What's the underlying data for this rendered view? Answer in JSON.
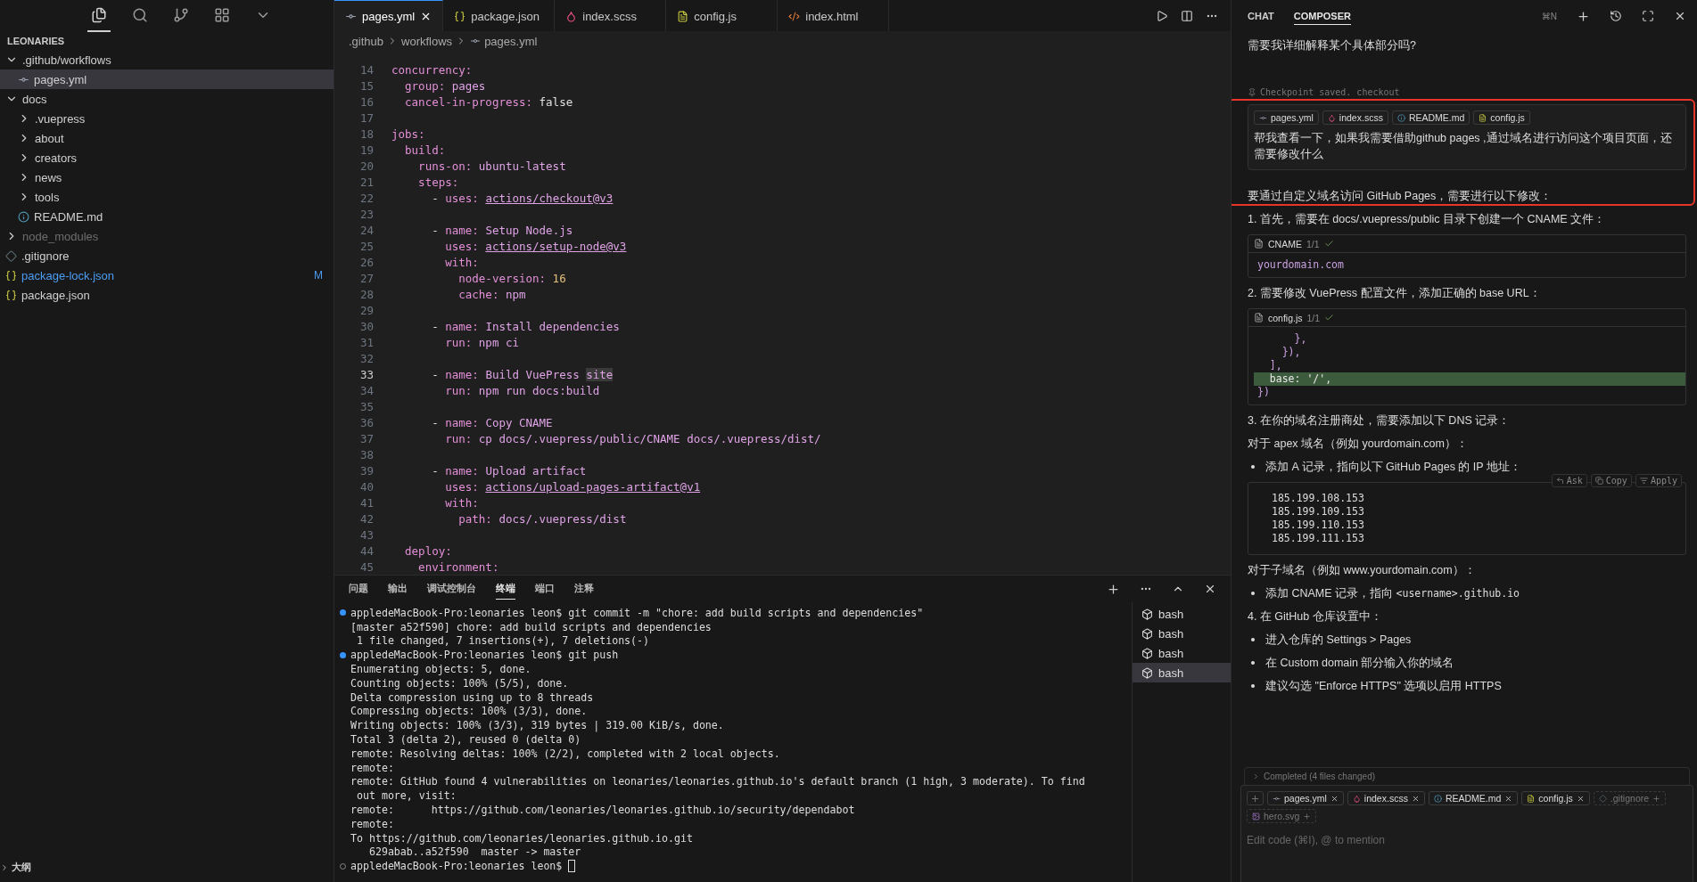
{
  "activity": [
    {
      "kind": "files",
      "selected": true
    },
    {
      "kind": "search",
      "selected": false
    },
    {
      "kind": "branch",
      "selected": false
    },
    {
      "kind": "extensions",
      "selected": false
    },
    {
      "kind": "more",
      "selected": false
    }
  ],
  "explorer": {
    "title": "LEONARIES",
    "items": [
      {
        "label": ".github/workflows",
        "kind": "folder",
        "expanded": true,
        "selected": false,
        "ignored": false,
        "children": [
          {
            "label": "pages.yml",
            "kind": "yml",
            "selected": true,
            "ignored": false
          }
        ]
      },
      {
        "label": "docs",
        "kind": "folder",
        "expanded": true,
        "selected": false,
        "ignored": false,
        "children": [
          {
            "label": ".vuepress",
            "kind": "folder",
            "expanded": false,
            "selected": false,
            "ignored": false
          },
          {
            "label": "about",
            "kind": "folder",
            "expanded": false,
            "selected": false,
            "ignored": false
          },
          {
            "label": "creators",
            "kind": "folder",
            "expanded": false,
            "selected": false,
            "ignored": false
          },
          {
            "label": "news",
            "kind": "folder",
            "expanded": false,
            "selected": false,
            "ignored": false
          },
          {
            "label": "tools",
            "kind": "folder",
            "expanded": false,
            "selected": false,
            "ignored": false
          },
          {
            "label": "README.md",
            "kind": "md",
            "selected": false,
            "ignored": false
          }
        ]
      },
      {
        "label": "node_modules",
        "kind": "folder",
        "expanded": false,
        "selected": false,
        "ignored": true
      },
      {
        "label": ".gitignore",
        "kind": "git",
        "selected": false,
        "ignored": false
      },
      {
        "label": "package-lock.json",
        "kind": "json",
        "selected": false,
        "ignored": false,
        "badge": "M"
      },
      {
        "label": "package.json",
        "kind": "json",
        "selected": false,
        "ignored": false
      }
    ],
    "sections": [
      "大纲"
    ]
  },
  "editor": {
    "tabs": [
      {
        "label": "pages.yml",
        "kind": "yml",
        "selected": true
      },
      {
        "label": "package.json",
        "kind": "json",
        "selected": false
      },
      {
        "label": "index.scss",
        "kind": "scss",
        "selected": false
      },
      {
        "label": "config.js",
        "kind": "js",
        "selected": false
      },
      {
        "label": "index.html",
        "kind": "html",
        "selected": false
      }
    ],
    "breadcrumb": [
      {
        "label": ".github",
        "kind": "folder"
      },
      {
        "label": "workflows",
        "kind": "folder"
      },
      {
        "label": "pages.yml",
        "kind": "yml"
      }
    ],
    "lines": [
      {
        "n": "14",
        "current": false,
        "parts": [
          {
            "kind": "key",
            "text": "concurrency:"
          }
        ]
      },
      {
        "n": "15",
        "current": false,
        "parts": [
          {
            "kind": "key",
            "text": "  group:"
          },
          {
            "kind": "str",
            "text": " pages"
          }
        ]
      },
      {
        "n": "16",
        "current": false,
        "parts": [
          {
            "kind": "key",
            "text": "  cancel-in-progress:"
          },
          {
            "kind": "plain",
            "text": " false"
          }
        ]
      },
      {
        "n": "17",
        "current": false
      },
      {
        "n": "18",
        "current": false,
        "parts": [
          {
            "kind": "key",
            "text": "jobs:"
          }
        ]
      },
      {
        "n": "19",
        "current": false,
        "parts": [
          {
            "kind": "key",
            "text": "  build:"
          }
        ]
      },
      {
        "n": "20",
        "current": false,
        "parts": [
          {
            "kind": "key",
            "text": "    runs-on:"
          },
          {
            "kind": "str",
            "text": " ubuntu-latest"
          }
        ]
      },
      {
        "n": "21",
        "current": false,
        "parts": [
          {
            "kind": "key",
            "text": "    steps:"
          }
        ]
      },
      {
        "n": "22",
        "current": false,
        "parts": [
          {
            "kind": "plain",
            "text": "      - "
          },
          {
            "kind": "key",
            "text": "uses: "
          },
          {
            "kind": "link",
            "text": "actions/checkout@v3"
          }
        ]
      },
      {
        "n": "23",
        "current": false
      },
      {
        "n": "24",
        "current": false,
        "parts": [
          {
            "kind": "plain",
            "text": "      - "
          },
          {
            "kind": "key",
            "text": "name:"
          },
          {
            "kind": "str",
            "text": " Setup Node.js"
          }
        ]
      },
      {
        "n": "25",
        "current": false,
        "parts": [
          {
            "kind": "key",
            "text": "        uses: "
          },
          {
            "kind": "link",
            "text": "actions/setup-node@v3"
          }
        ]
      },
      {
        "n": "26",
        "current": false,
        "parts": [
          {
            "kind": "key",
            "text": "        with:"
          }
        ]
      },
      {
        "n": "27",
        "current": false,
        "parts": [
          {
            "kind": "key",
            "text": "          node-version:"
          },
          {
            "kind": "num",
            "text": " 16"
          }
        ]
      },
      {
        "n": "28",
        "current": false,
        "parts": [
          {
            "kind": "key",
            "text": "          cache:"
          },
          {
            "kind": "str",
            "text": " npm"
          }
        ]
      },
      {
        "n": "29",
        "current": false
      },
      {
        "n": "30",
        "current": false,
        "parts": [
          {
            "kind": "plain",
            "text": "      - "
          },
          {
            "kind": "key",
            "text": "name:"
          },
          {
            "kind": "str",
            "text": " Install dependencies"
          }
        ]
      },
      {
        "n": "31",
        "current": false,
        "parts": [
          {
            "kind": "key",
            "text": "        run:"
          },
          {
            "kind": "str",
            "text": " npm ci"
          }
        ]
      },
      {
        "n": "32",
        "current": false
      },
      {
        "n": "33",
        "current": true,
        "parts": [
          {
            "kind": "plain",
            "text": "      - "
          },
          {
            "kind": "key",
            "text": "name:"
          },
          {
            "kind": "str",
            "text": " Build VuePress "
          },
          {
            "kind": "match",
            "text": "site"
          }
        ]
      },
      {
        "n": "34",
        "current": false,
        "parts": [
          {
            "kind": "key",
            "text": "        run:"
          },
          {
            "kind": "str",
            "text": " npm run docs:build"
          }
        ]
      },
      {
        "n": "35",
        "current": false
      },
      {
        "n": "36",
        "current": false,
        "parts": [
          {
            "kind": "plain",
            "text": "      - "
          },
          {
            "kind": "key",
            "text": "name:"
          },
          {
            "kind": "str",
            "text": " Copy CNAME"
          }
        ]
      },
      {
        "n": "37",
        "current": false,
        "parts": [
          {
            "kind": "key",
            "text": "        run:"
          },
          {
            "kind": "str",
            "text": " cp docs/.vuepress/public/CNAME docs/.vuepress/dist/"
          }
        ]
      },
      {
        "n": "38",
        "current": false
      },
      {
        "n": "39",
        "current": false,
        "parts": [
          {
            "kind": "plain",
            "text": "      - "
          },
          {
            "kind": "key",
            "text": "name:"
          },
          {
            "kind": "str",
            "text": " Upload artifact"
          }
        ]
      },
      {
        "n": "40",
        "current": false,
        "parts": [
          {
            "kind": "key",
            "text": "        uses: "
          },
          {
            "kind": "link",
            "text": "actions/upload-pages-artifact@v1"
          }
        ]
      },
      {
        "n": "41",
        "current": false,
        "parts": [
          {
            "kind": "key",
            "text": "        with:"
          }
        ]
      },
      {
        "n": "42",
        "current": false,
        "parts": [
          {
            "kind": "key",
            "text": "          path:"
          },
          {
            "kind": "str",
            "text": " docs/.vuepress/dist"
          }
        ]
      },
      {
        "n": "43",
        "current": false
      },
      {
        "n": "44",
        "current": false,
        "parts": [
          {
            "kind": "key",
            "text": "  deploy:"
          }
        ]
      },
      {
        "n": "45",
        "current": false,
        "parts": [
          {
            "kind": "key",
            "text": "    environment:"
          }
        ]
      }
    ]
  },
  "panel": {
    "tabs": [
      {
        "label": "问题",
        "selected": false
      },
      {
        "label": "输出",
        "selected": false
      },
      {
        "label": "调试控制台",
        "selected": false
      },
      {
        "label": "终端",
        "selected": true
      },
      {
        "label": "端口",
        "selected": false
      },
      {
        "label": "注释",
        "selected": false
      }
    ],
    "terminal": [
      {
        "kind": "command",
        "text": "appledeMacBook-Pro:leonaries leon$ git commit -m \"chore: add build scripts and dependencies\""
      },
      {
        "kind": "output",
        "text": "[master a52f590] chore: add build scripts and dependencies"
      },
      {
        "kind": "output",
        "text": " 1 file changed, 7 insertions(+), 7 deletions(-)"
      },
      {
        "kind": "command",
        "text": "appledeMacBook-Pro:leonaries leon$ git push"
      },
      {
        "kind": "output",
        "text": "Enumerating objects: 5, done."
      },
      {
        "kind": "output",
        "text": "Counting objects: 100% (5/5), done."
      },
      {
        "kind": "output",
        "text": "Delta compression using up to 8 threads"
      },
      {
        "kind": "output",
        "text": "Compressing objects: 100% (3/3), done."
      },
      {
        "kind": "output",
        "text": "Writing objects: 100% (3/3), 319 bytes | 319.00 KiB/s, done."
      },
      {
        "kind": "output",
        "text": "Total 3 (delta 2), reused 0 (delta 0)"
      },
      {
        "kind": "output",
        "text": "remote: Resolving deltas: 100% (2/2), completed with 2 local objects."
      },
      {
        "kind": "output",
        "text": "remote:"
      },
      {
        "kind": "output",
        "text": "remote: GitHub found 4 vulnerabilities on leonaries/leonaries.github.io's default branch (1 high, 3 moderate). To find"
      },
      {
        "kind": "output",
        "text": " out more, visit:"
      },
      {
        "kind": "output",
        "text": "remote:      https://github.com/leonaries/leonaries.github.io/security/dependabot"
      },
      {
        "kind": "output",
        "text": "remote:"
      },
      {
        "kind": "output",
        "text": "To https://github.com/leonaries/leonaries.github.io.git"
      },
      {
        "kind": "output",
        "text": "   629abab..a52f590  master -> master"
      },
      {
        "kind": "prompt",
        "text": "appledeMacBook-Pro:leonaries leon$ "
      }
    ],
    "sessions": [
      {
        "label": "bash",
        "selected": false
      },
      {
        "label": "bash",
        "selected": false
      },
      {
        "label": "bash",
        "selected": false
      },
      {
        "label": "bash",
        "selected": true
      }
    ]
  },
  "chat": {
    "tabs": [
      {
        "label": "CHAT",
        "selected": false
      },
      {
        "label": "COMPOSER",
        "selected": true
      }
    ],
    "shortcut": "⌘N",
    "previous": "需要我详细解释某个具体部分吗?",
    "checkpoint": "Checkpoint saved. checkout",
    "user_message": {
      "files": [
        {
          "label": "pages.yml",
          "kind": "yml"
        },
        {
          "label": "index.scss",
          "kind": "scss"
        },
        {
          "label": "README.md",
          "kind": "md"
        },
        {
          "label": "config.js",
          "kind": "js"
        }
      ],
      "text": "帮我查看一下，如果我需要借助github pages ,通过域名进行访问这个项目页面，还需要修改什么"
    },
    "intro": "要通过自定义域名访问 GitHub Pages，需要进行以下修改：",
    "blocks": [
      {
        "kind": "para",
        "text": "1. 首先，需要在 docs/.vuepress/public 目录下创建一个 CNAME 文件："
      },
      {
        "kind": "file",
        "file": "CNAME",
        "count": "1/1",
        "lines": [
          {
            "text": "yourdomain.com",
            "added": false
          }
        ]
      },
      {
        "kind": "para",
        "text": "2. 需要修改 VuePress 配置文件，添加正确的 base URL："
      },
      {
        "kind": "file",
        "file": "config.js",
        "count": "1/1",
        "lines": [
          {
            "text": "      },",
            "added": false
          },
          {
            "text": "    }),",
            "added": false
          },
          {
            "text": "  ],",
            "added": false
          },
          {
            "text": "  base: '/',",
            "added": true
          },
          {
            "text": "})",
            "added": false
          }
        ]
      },
      {
        "kind": "para",
        "text": "3. 在你的域名注册商处，需要添加以下 DNS 记录："
      },
      {
        "kind": "para",
        "text": "对于 apex 域名（例如 yourdomain.com）："
      },
      {
        "kind": "bullet",
        "text": "添加 A 记录，指向以下 GitHub Pages 的 IP 地址："
      },
      {
        "kind": "code",
        "actions": [
          "Ask",
          "Copy",
          "Apply"
        ],
        "lines": [
          "185.199.108.153",
          "185.199.109.153",
          "185.199.110.153",
          "185.199.111.153"
        ]
      },
      {
        "kind": "para",
        "text": "对于子域名（例如 www.yourdomain.com）："
      },
      {
        "kind": "bullet",
        "text": "添加 CNAME 记录，指向 ",
        "code": "<username>.github.io"
      },
      {
        "kind": "para",
        "text": "4. 在 GitHub 仓库设置中："
      },
      {
        "kind": "bullet",
        "text": "进入仓库的 Settings > Pages"
      },
      {
        "kind": "bullet",
        "text": "在 Custom domain 部分输入你的域名"
      },
      {
        "kind": "bullet",
        "text": "建议勾选 \"Enforce HTTPS\" 选项以启用 HTTPS"
      }
    ],
    "completed": "Completed (4 files changed)",
    "composer": {
      "chips": [
        {
          "label": "pages.yml",
          "kind": "yml",
          "attached": true
        },
        {
          "label": "index.scss",
          "kind": "scss",
          "attached": true
        },
        {
          "label": "README.md",
          "kind": "md",
          "attached": true
        },
        {
          "label": "config.js",
          "kind": "js",
          "attached": true
        },
        {
          "label": ".gitignore",
          "kind": "git",
          "attached": false
        },
        {
          "label": "hero.svg",
          "kind": "img",
          "attached": false
        }
      ],
      "placeholder": "Edit code (⌘I), @ to mention"
    }
  }
}
